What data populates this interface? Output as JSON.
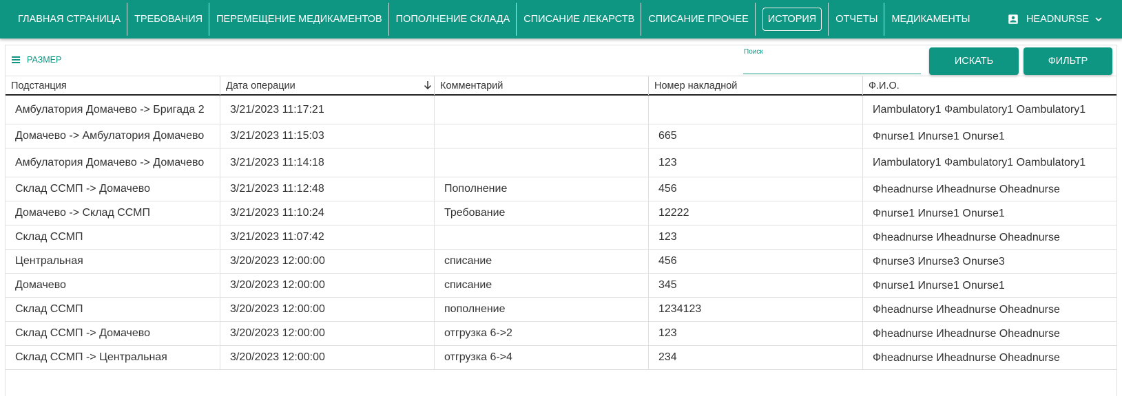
{
  "nav": {
    "items": [
      "Главная страница",
      "Требования",
      "Перемещение медикаментов",
      "Пополнение склада",
      "Списание лекарств",
      "Списание прочее",
      "История",
      "Отчеты",
      "Медикаменты"
    ],
    "active_index": 6,
    "user_name": "HEADNURSE"
  },
  "toolbar": {
    "density_label": "Размер",
    "search_label": "Поиск",
    "search_value": "",
    "search_button": "Искать",
    "filter_button": "Фильтр"
  },
  "table": {
    "columns": [
      "Подстанция",
      "Дата операции",
      "Комментарий",
      "Номер накладной",
      "Ф.И.О."
    ],
    "sorted_column": "Дата операции",
    "sort_direction": "desc",
    "rows": [
      [
        "Амбулатория Домачево -> Бригада 2",
        "3/21/2023 11:17:21",
        "",
        "",
        "Иambulatory1 Фambulatory1 Оambulatory1"
      ],
      [
        "Домачево -> Амбулатория Домачево",
        "3/21/2023 11:15:03",
        "",
        "665",
        "Фnurse1 Иnurse1 Оnurse1"
      ],
      [
        "Амбулатория Домачево -> Домачево",
        "3/21/2023 11:14:18",
        "",
        "123",
        "Иambulatory1 Фambulatory1 Оambulatory1"
      ],
      [
        "Склад ССМП -> Домачево",
        "3/21/2023 11:12:48",
        "Пополнение",
        "456",
        "Фheadnurse Иheadnurse Оheadnurse"
      ],
      [
        "Домачево -> Склад ССМП",
        "3/21/2023 11:10:24",
        "Требование",
        "12222",
        "Фnurse1 Иnurse1 Оnurse1"
      ],
      [
        "Склад ССМП",
        "3/21/2023 11:07:42",
        "",
        "123",
        "Фheadnurse Иheadnurse Оheadnurse"
      ],
      [
        "Центральная",
        "3/20/2023 12:00:00",
        "списание",
        "456",
        "Фnurse3 Иnurse3 Оnurse3"
      ],
      [
        "Домачево",
        "3/20/2023 12:00:00",
        "списание",
        "345",
        "Фnurse1 Иnurse1 Оnurse1"
      ],
      [
        "Склад ССМП",
        "3/20/2023 12:00:00",
        "пополнение",
        "1234123",
        "Фheadnurse Иheadnurse Оheadnurse"
      ],
      [
        "Склад ССМП -> Домачево",
        "3/20/2023 12:00:00",
        "отгрузка 6->2",
        "123",
        "Фheadnurse Иheadnurse Оheadnurse"
      ],
      [
        "Склад ССМП -> Центральная",
        "3/20/2023 12:00:00",
        "отгрузка 6->4",
        "234",
        "Фheadnurse Иheadnurse Оheadnurse"
      ]
    ]
  },
  "colors": {
    "primary": "#0e9683",
    "header_text": "#ffffff",
    "row_border": "#e0e0e0"
  },
  "icons": {
    "density": "menu-lines-icon",
    "sort": "arrow-down-icon",
    "user": "account-box-icon",
    "user_menu": "chevron-down-icon"
  }
}
